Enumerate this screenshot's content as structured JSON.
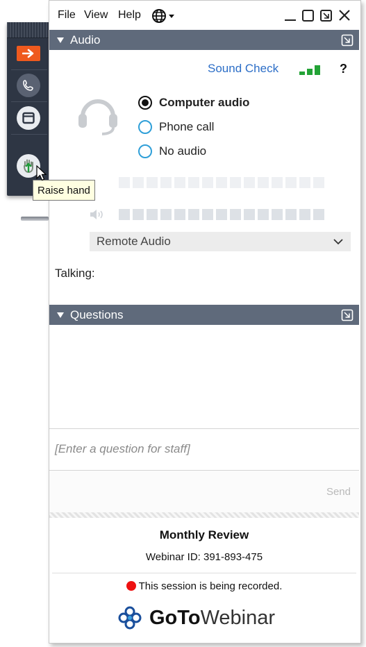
{
  "menu": {
    "file": "File",
    "view": "View",
    "help": "Help"
  },
  "tooltip": {
    "text": "Raise hand"
  },
  "audio_panel": {
    "title": "Audio",
    "sound_check": "Sound Check",
    "help_mark": "?",
    "options": [
      {
        "label": "Computer audio",
        "selected": true
      },
      {
        "label": "Phone call",
        "selected": false
      },
      {
        "label": "No audio",
        "selected": false
      }
    ],
    "device": "Remote Audio",
    "talking_label": "Talking:"
  },
  "questions_panel": {
    "title": "Questions",
    "placeholder": "[Enter a question for staff]",
    "send_label": "Send"
  },
  "footer": {
    "meeting_title": "Monthly Review",
    "webinar_id": "Webinar ID: 391-893-475",
    "recording_notice": "This session is being recorded.",
    "brand_goto": "GoTo",
    "brand_webinar": "Webinar"
  },
  "colors": {
    "accent_orange": "#ef5a1e",
    "panel_header": "#5f6a7b",
    "link_blue": "#2c6ec7",
    "signal_green": "#23a336",
    "record_red": "#e11111"
  },
  "icons": {
    "toolbar": [
      "arrow-right-icon",
      "phone-icon",
      "window-icon",
      "raise-hand-icon"
    ],
    "menubar": [
      "globe-icon",
      "minimize-icon",
      "maximize-icon",
      "popout-icon",
      "close-icon"
    ],
    "audio": [
      "headset-icon",
      "signal-bars-icon",
      "speaker-icon",
      "chevron-down-icon"
    ],
    "footer": [
      "goto-logo-icon",
      "record-dot-icon"
    ]
  }
}
